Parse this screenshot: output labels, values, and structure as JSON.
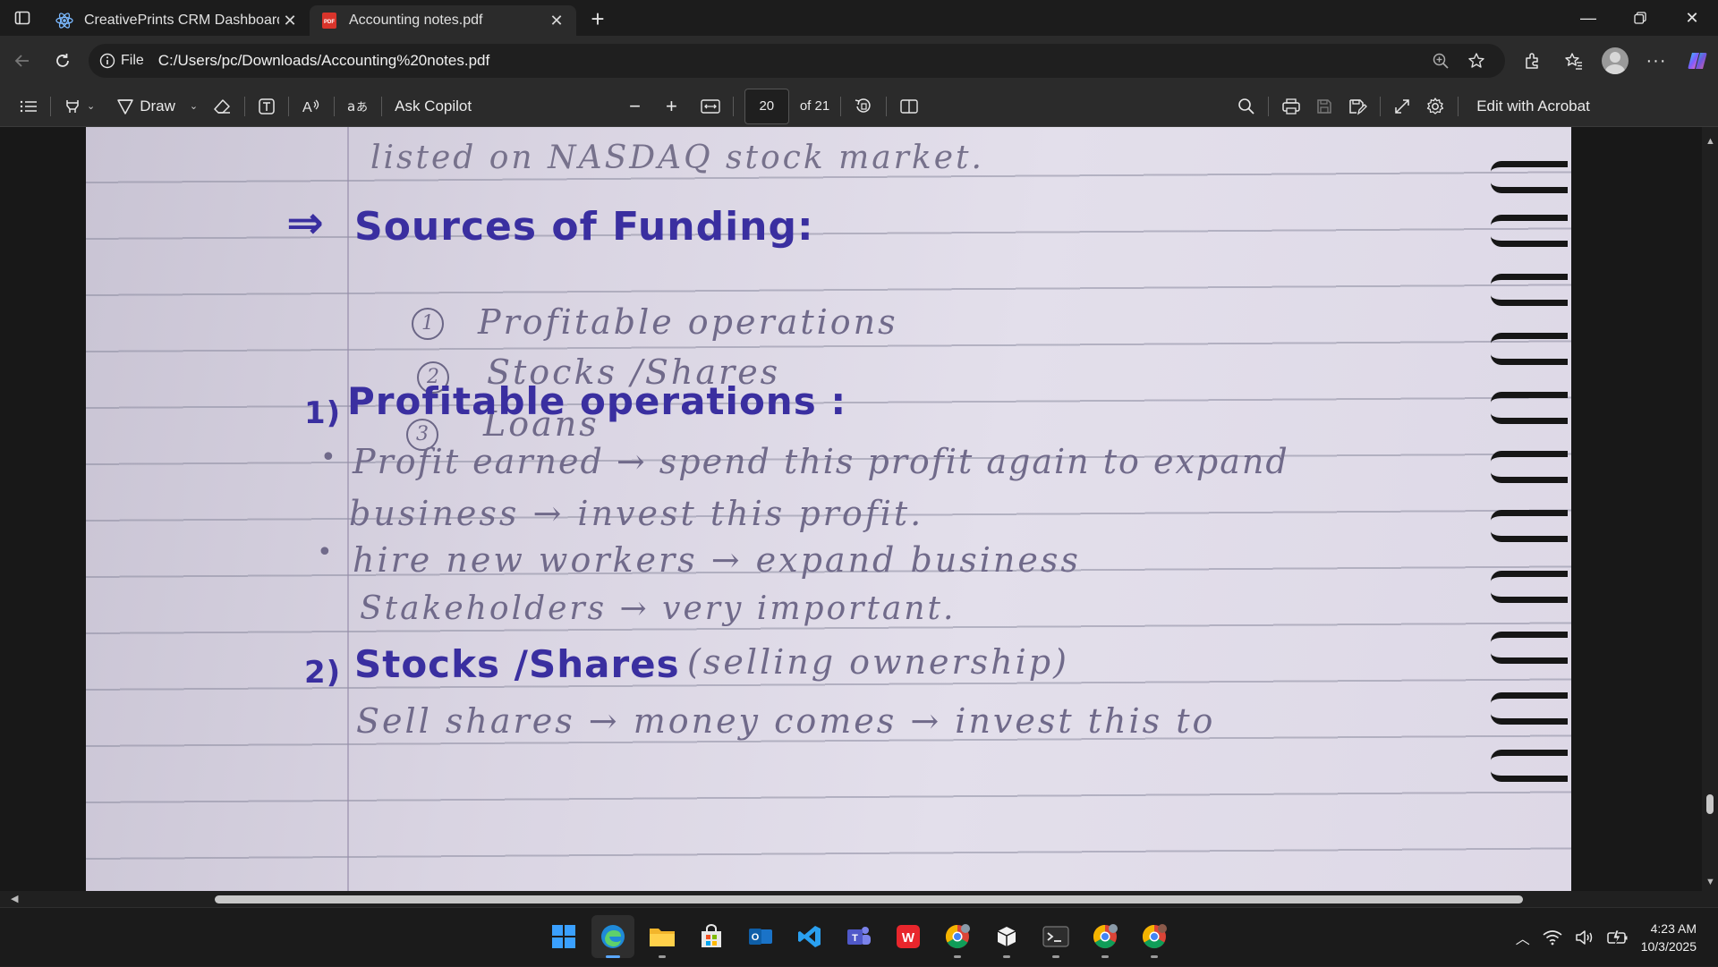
{
  "tabs": [
    {
      "title": "CreativePrints CRM Dashboard",
      "icon": "react-icon",
      "active": false
    },
    {
      "title": "Accounting notes.pdf",
      "icon": "pdf-icon",
      "active": true
    }
  ],
  "address": {
    "site_label": "File",
    "url": "C:/Users/pc/Downloads/Accounting%20notes.pdf"
  },
  "pdf_toolbar": {
    "draw_label": "Draw",
    "copilot_label": "Ask Copilot",
    "page_current": "20",
    "page_total": "of 21",
    "acrobat_label": "Edit with Acrobat"
  },
  "notes": {
    "line_top": "listed on NASDAQ stock market.",
    "heading_sources": "Sources of Funding:",
    "sources": [
      "Profitable operations",
      "Stocks /Shares",
      "Loans"
    ],
    "source_markers": [
      "1",
      "2",
      "3"
    ],
    "heading_profitable": "Profitable operations :",
    "profit_line1": "Profit earned → spend this profit again to expand",
    "profit_line2": "business → invest this profit.",
    "profit_line3": "hire new workers → expand business",
    "profit_line4": "Stakeholders → very important.",
    "heading_stocks": "Stocks /Shares",
    "stocks_note": "(selling ownership)",
    "stocks_line1": "Sell shares → money comes → invest this to",
    "num_1": "1)",
    "num_2": "2)",
    "arrow_mark": "⇒"
  },
  "clock": {
    "time": "4:23 AM",
    "date": "10/3/2025"
  },
  "colors": {
    "ink_blue": "#3a2fa0",
    "pencil": "#706a8a",
    "chrome_dark": "#2b2b2b"
  }
}
